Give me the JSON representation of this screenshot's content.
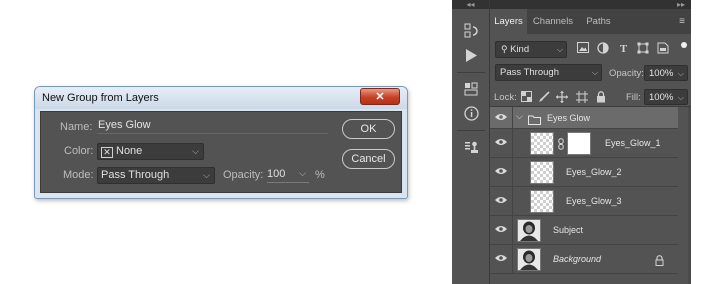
{
  "dialog": {
    "title": "New Group from Layers",
    "close_glyph": "✕",
    "name_label": "Name:",
    "name_value": "Eyes Glow",
    "color_label": "Color:",
    "color_box_glyph": "✕",
    "color_value": "None",
    "mode_label": "Mode:",
    "mode_value": "Pass Through",
    "opacity_label": "Opacity:",
    "opacity_value": "100",
    "opacity_unit": "%",
    "ok_label": "OK",
    "cancel_label": "Cancel"
  },
  "toolstrip": {
    "collapse_glyph": "◂◂"
  },
  "panel": {
    "collapse_glyph": "▸▸",
    "tabs": [
      {
        "label": "Layers",
        "active": true
      },
      {
        "label": "Channels",
        "active": false
      },
      {
        "label": "Paths",
        "active": false
      }
    ],
    "menu_glyph": "≡",
    "filter_kind": "Kind",
    "blend_mode": "Pass Through",
    "opacity_label": "Opacity:",
    "opacity_value": "100%",
    "lock_label": "Lock:",
    "fill_label": "Fill:",
    "fill_value": "100%",
    "layers": [
      {
        "name": "Eyes Glow",
        "kind": "group",
        "selected": true
      },
      {
        "name": "Eyes_Glow_1",
        "kind": "masked"
      },
      {
        "name": "Eyes_Glow_2",
        "kind": "pixel"
      },
      {
        "name": "Eyes_Glow_3",
        "kind": "pixel"
      },
      {
        "name": "Subject",
        "kind": "photo"
      },
      {
        "name": "Background",
        "kind": "photo-locked"
      }
    ]
  },
  "colors": {
    "panel_bg": "#535353",
    "selected_row": "#6b6b6b",
    "dialog_titlebar": "#d9e4f1",
    "close_button": "#c64025",
    "name_underline": "#2f6fd0"
  }
}
